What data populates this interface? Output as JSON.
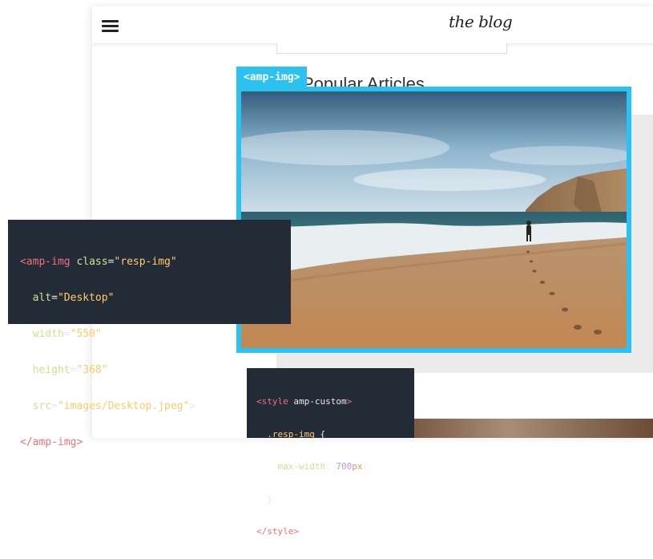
{
  "header": {
    "menu_icon": "hamburger-menu-icon",
    "logo_text": "the blog"
  },
  "section": {
    "heading": "Popular Articles"
  },
  "highlight": {
    "tag_label": "<amp-img>",
    "color": "#2cc2f0"
  },
  "code_amp": {
    "line1": {
      "open": "<amp-img",
      "attr": "class",
      "eq": "=",
      "val": "\"resp-img\""
    },
    "line2": {
      "attr": "alt",
      "eq": "=",
      "val": "\"Desktop\""
    },
    "line3": {
      "attr": "width",
      "eq": "=",
      "val": "\"550\""
    },
    "line4": {
      "attr": "height",
      "eq": "=",
      "val": "\"368\""
    },
    "line5": {
      "attr": "src",
      "eq": "=",
      "val": "\"images/Desktop.jpeg\"",
      "close": ">"
    },
    "line6": {
      "close_tag": "</amp-img>"
    }
  },
  "code_style": {
    "line1": {
      "tag": "<style",
      "attr": "amp-custom",
      "end": ">"
    },
    "line2": {
      "selector": ".resp-img",
      "brace": "{"
    },
    "line3": {
      "prop": "max-width",
      "colon": ":",
      "num": "700",
      "unit": "px",
      "semi": ";"
    },
    "line4": {
      "brace": "}"
    },
    "line5": {
      "close_tag": "</style>"
    }
  },
  "colors": {
    "code_bg": "#232b37",
    "tag": "#f07178",
    "attr": "#c3e88d",
    "string": "#ffcb6b",
    "number": "#c792ea"
  }
}
